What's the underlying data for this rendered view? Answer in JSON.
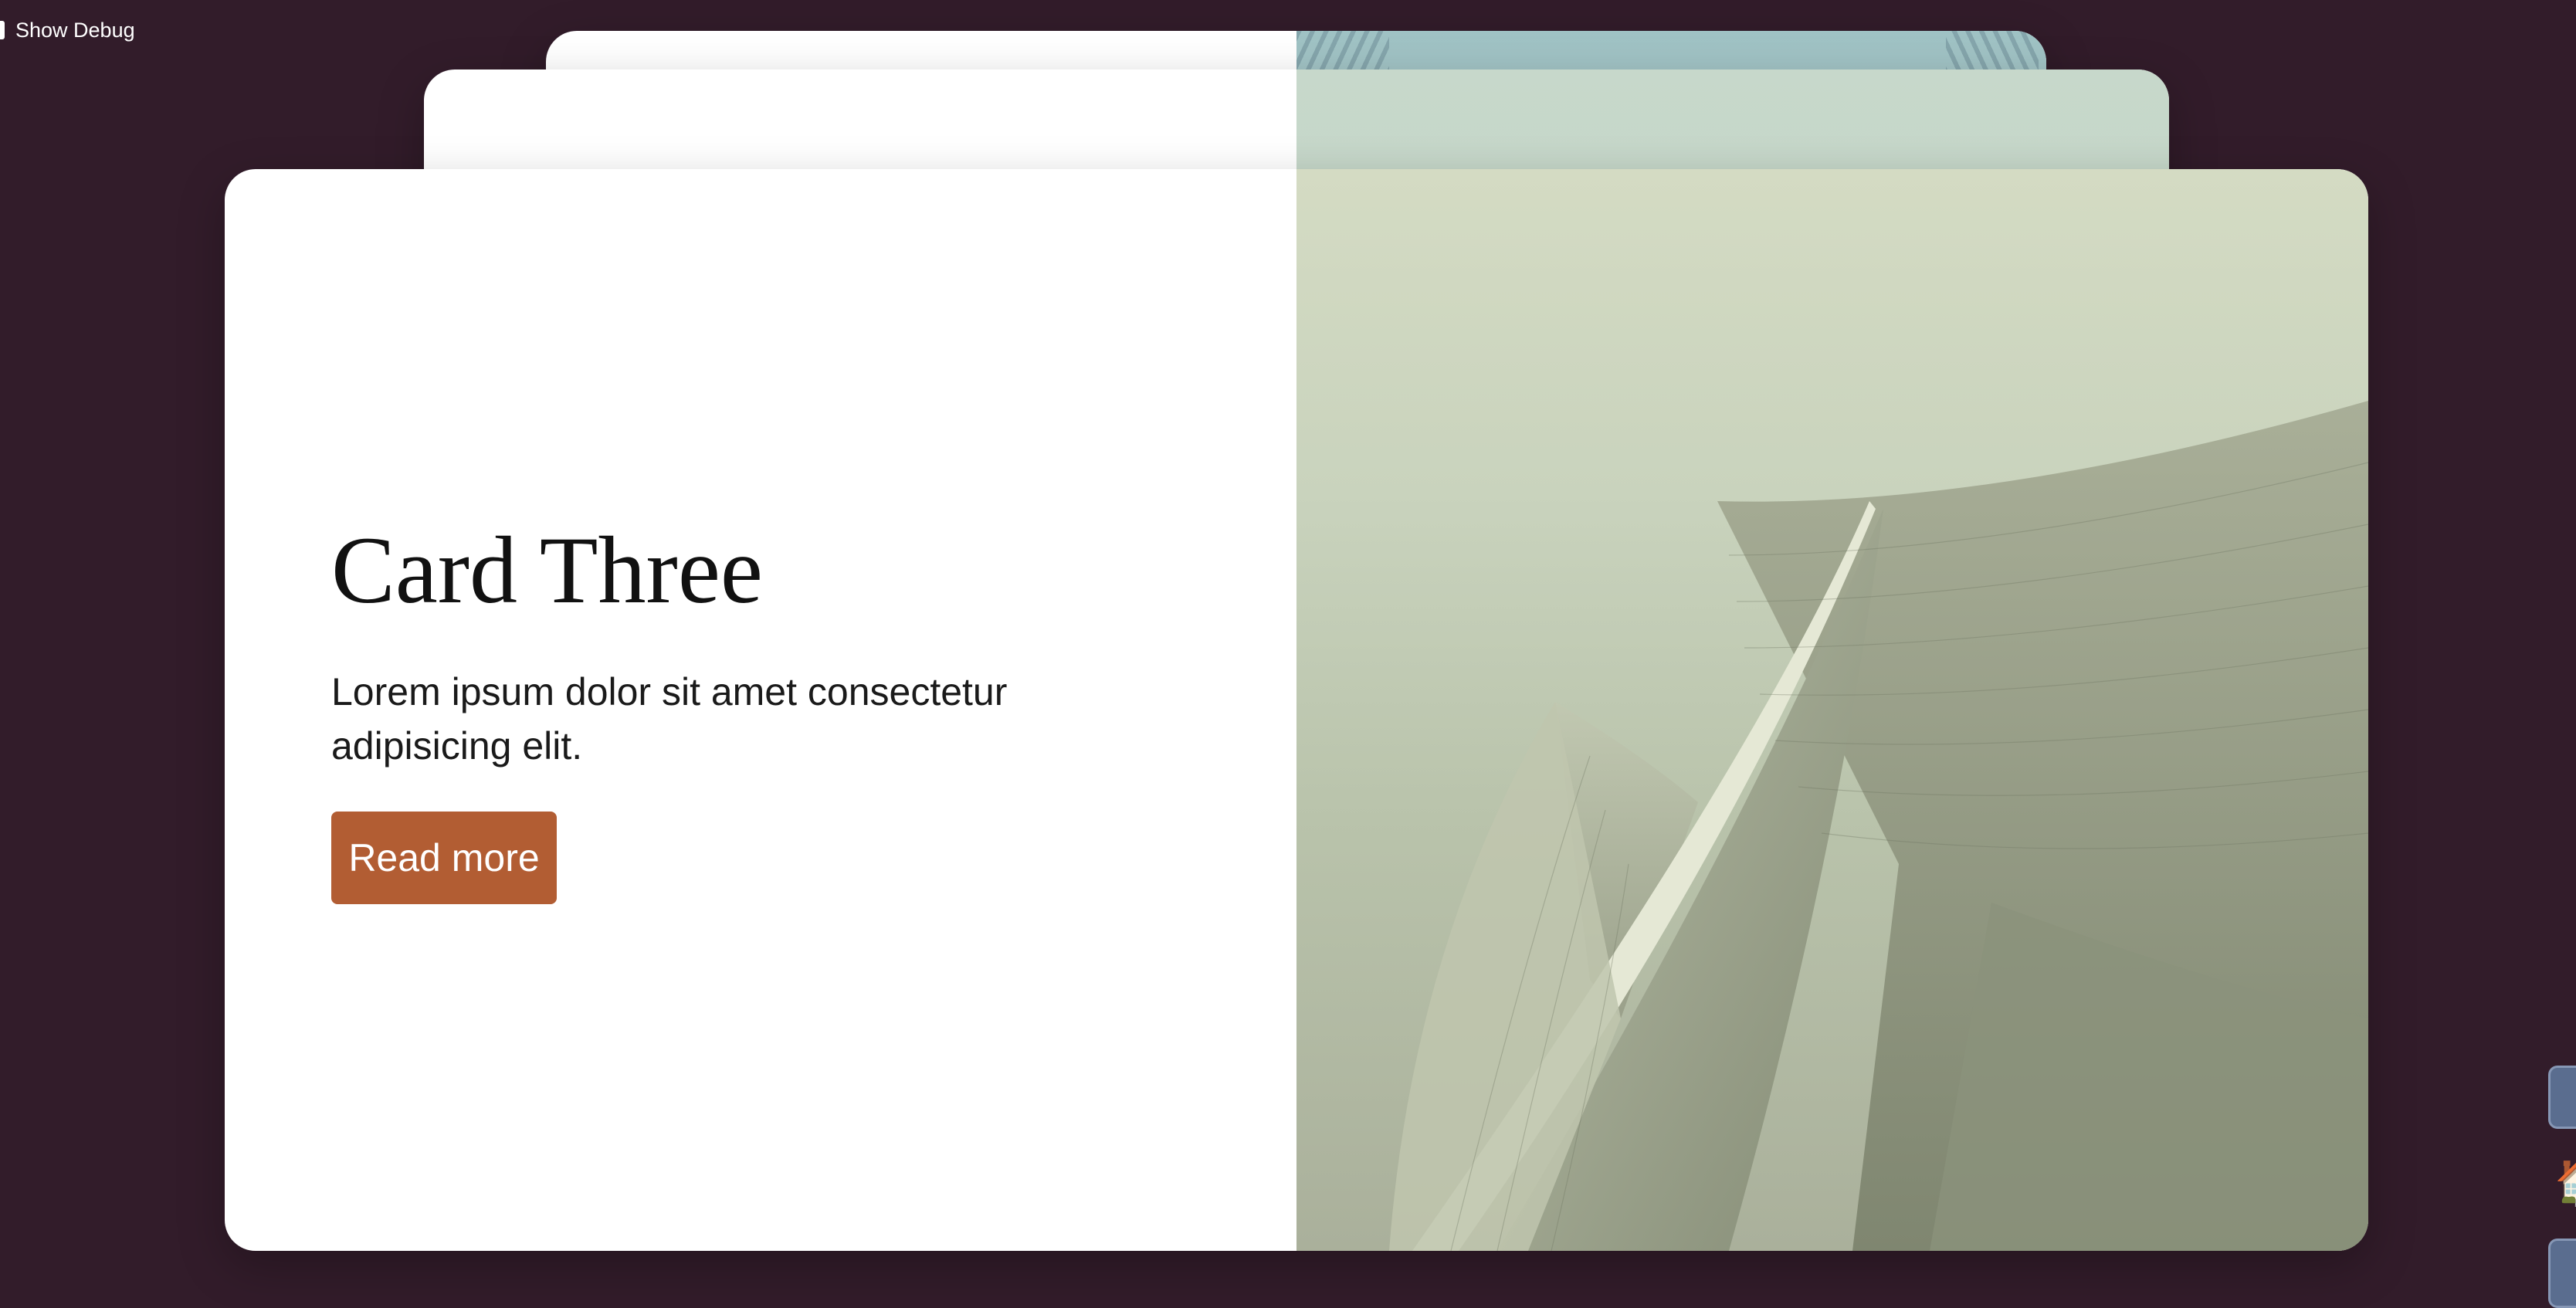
{
  "debug": {
    "label": "Show Debug"
  },
  "cards": {
    "front": {
      "title": "Card Three",
      "text": "Lorem ipsum dolor sit amet consectetur adipisicing elit.",
      "button_label": "Read more"
    }
  },
  "colors": {
    "background": "#321c2a",
    "button": "#b25d33",
    "card": "#ffffff"
  },
  "edge_widgets": {
    "icons": [
      "panel-toggle-icon",
      "home-icon",
      "panel-tab-icon"
    ],
    "home_glyph": "🏠"
  }
}
